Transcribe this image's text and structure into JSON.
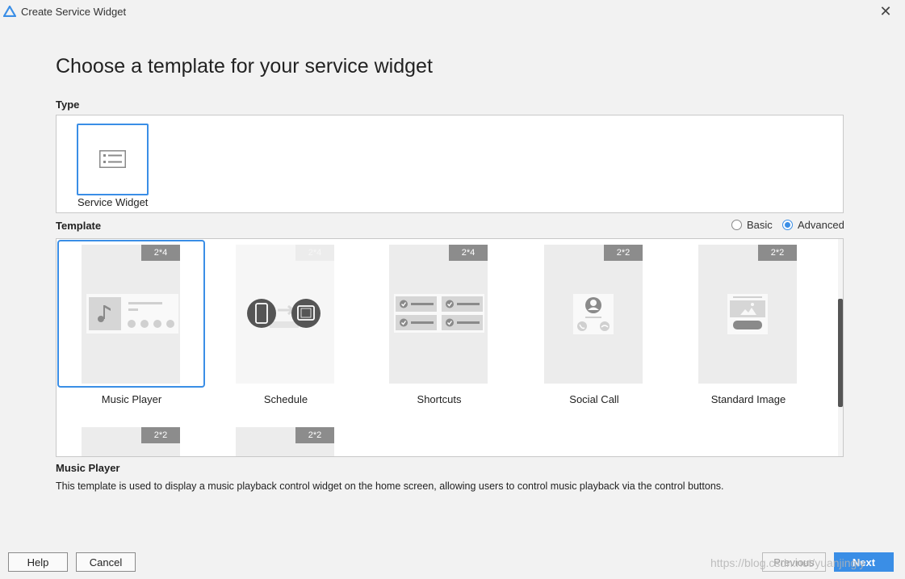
{
  "window": {
    "title": "Create Service Widget",
    "close_glyph": "✕"
  },
  "heading": "Choose a template for your service widget",
  "type_section": {
    "label": "Type",
    "items": [
      {
        "label": "Service Widget",
        "icon": "list-widget-icon",
        "selected": true
      }
    ]
  },
  "template_section": {
    "label": "Template",
    "radio": {
      "basic": "Basic",
      "advanced": "Advanced",
      "selected": "advanced"
    },
    "items": [
      {
        "name": "Music Player",
        "size": "2*4",
        "selected": true
      },
      {
        "name": "Schedule",
        "size": "2*4",
        "selected": false
      },
      {
        "name": "Shortcuts",
        "size": "2*4",
        "selected": false
      },
      {
        "name": "Social Call",
        "size": "2*2",
        "selected": false
      },
      {
        "name": "Standard Image",
        "size": "2*2",
        "selected": false
      },
      {
        "name": "",
        "size": "2*2",
        "selected": false
      },
      {
        "name": "",
        "size": "2*2",
        "selected": false
      }
    ]
  },
  "description": {
    "title": "Music Player",
    "text": "This template is used to display a music playback control widget on the home screen, allowing users to control music playback via the control buttons."
  },
  "buttons": {
    "help": "Help",
    "cancel": "Cancel",
    "previous": "Previous",
    "next": "Next"
  },
  "watermark": "https://blog.csdn.net/yuanjingly",
  "colors": {
    "accent": "#3a8ee6",
    "badge": "#8c8c8c",
    "placeholder": "#ececec"
  }
}
